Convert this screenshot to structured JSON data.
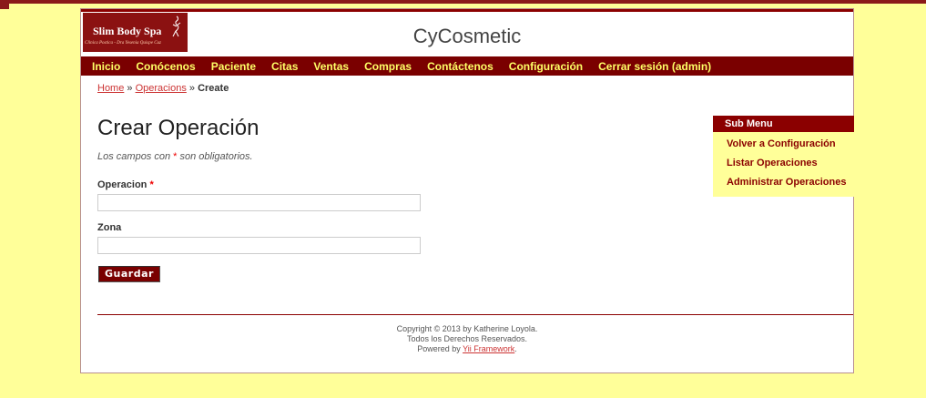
{
  "logo": {
    "name": "Slim Body Spa",
    "subtitle": "Clinica Postica - Dra Yesenia Quispe Cuz"
  },
  "site_title": "CyCosmetic",
  "nav": [
    "Inicio",
    "Conócenos",
    "Paciente",
    "Citas",
    "Ventas",
    "Compras",
    "Contáctenos",
    "Configuración",
    "Cerrar sesión (admin)"
  ],
  "breadcrumb": {
    "home": "Home",
    "sep1": " » ",
    "section": "Operacions",
    "sep2": " » ",
    "current": "Create"
  },
  "page_title": "Crear Operación",
  "required_note": {
    "before": "Los campos con ",
    "star": "*",
    "after": " son obligatorios."
  },
  "form": {
    "operacion_label": "Operacion",
    "operacion_value": "",
    "zona_label": "Zona",
    "zona_value": "",
    "submit_label": "Guardar"
  },
  "sidebar": {
    "title": "Sub Menu",
    "items": [
      "Volver a Configuración",
      "Listar Operaciones",
      "Administrar Operaciones"
    ]
  },
  "footer": {
    "line1": "Copyright © 2013 by Katherine Loyola.",
    "line2": "Todos los Derechos Reservados.",
    "powered_prefix": "Powered by ",
    "powered_link": "Yii Framework",
    "powered_suffix": "."
  },
  "colors": {
    "brand": "#7a0000",
    "background": "#ffff99",
    "nav_text": "#ffff66"
  }
}
